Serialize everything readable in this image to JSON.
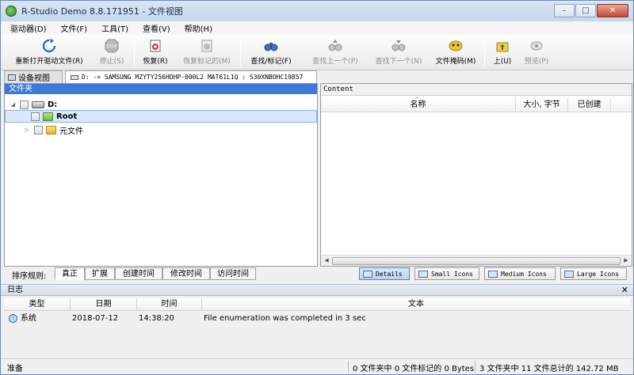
{
  "window": {
    "title": "R-Studio Demo 8.8.171951 - 文件视图",
    "buttons": {
      "minimize": "–",
      "maximize": "□",
      "close": "✕"
    }
  },
  "menu": [
    "驱动器(D)",
    "文件(F)",
    "工具(T)",
    "查看(V)",
    "帮助(H)"
  ],
  "toolbar": {
    "rescan": "重新打开驱动文件(R)",
    "stop": "停止(S)",
    "recover": "恢复(R)",
    "recover_marked": "恢复标记的(M)",
    "find_mark": "查找/标记(F)",
    "find_prev": "查找上一个(P)",
    "find_next": "查找下一个(N)",
    "file_mask": "文件掩码(M)",
    "up": "上(U)",
    "preview": "预览(P)"
  },
  "tabs": {
    "device_view": "设备视图",
    "file_view": "D: -> SAMSUNG MZYTY256HDHP-000L2 MAT61L1Q : S30XNBOHC19857"
  },
  "folders": {
    "header": "文件夹",
    "drive": "D:",
    "root": "Root",
    "metafiles": "元文件"
  },
  "content": {
    "header": "Content",
    "col_name": "名称",
    "col_size": "大小, 字节",
    "col_created": "已创建"
  },
  "sort": {
    "label": "排序规则:",
    "options": [
      "真正",
      "扩展",
      "创建时间",
      "修改时间",
      "访问时间"
    ]
  },
  "views": [
    "Details",
    "Small Icons",
    "Medium Icons",
    "Large Icons"
  ],
  "log": {
    "title": "日志",
    "close": "✕",
    "columns": {
      "type": "类型",
      "date": "日期",
      "time": "时间",
      "text": "文本"
    },
    "rows": [
      {
        "type": "系统",
        "date": "2018-07-12",
        "time": "14:38:20",
        "text": "File enumeration was completed in 3 sec"
      }
    ]
  },
  "status": {
    "ready": "准备",
    "selected": "0 文件夹中 0 文件标记的 0 Bytes",
    "total": "3 文件夹中 11 文件总计的 142.72 MB"
  }
}
